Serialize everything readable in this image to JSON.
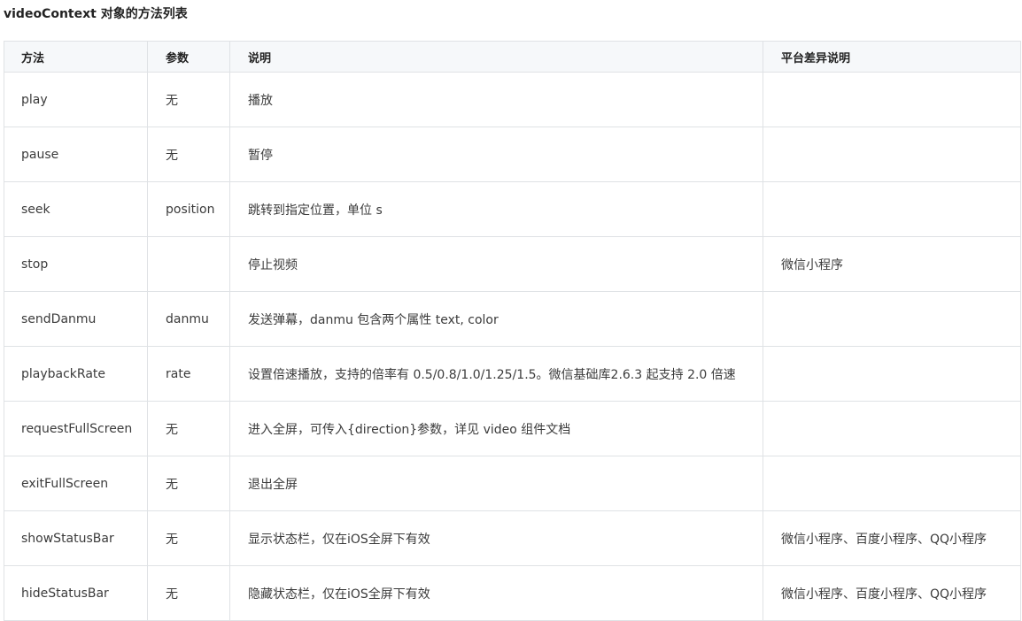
{
  "title": "videoContext 对象的方法列表",
  "table": {
    "headers": [
      "方法",
      "参数",
      "说明",
      "平台差异说明"
    ],
    "rows": [
      [
        "play",
        "无",
        "播放",
        ""
      ],
      [
        "pause",
        "无",
        "暂停",
        ""
      ],
      [
        "seek",
        "position",
        "跳转到指定位置，单位 s",
        ""
      ],
      [
        "stop",
        "",
        "停止视频",
        "微信小程序"
      ],
      [
        "sendDanmu",
        "danmu",
        "发送弹幕，danmu 包含两个属性 text, color",
        ""
      ],
      [
        "playbackRate",
        "rate",
        "设置倍速播放，支持的倍率有 0.5/0.8/1.0/1.25/1.5。微信基础库2.6.3 起支持 2.0 倍速",
        ""
      ],
      [
        "requestFullScreen",
        "无",
        "进入全屏，可传入{direction}参数，详见 video 组件文档",
        ""
      ],
      [
        "exitFullScreen",
        "无",
        "退出全屏",
        ""
      ],
      [
        "showStatusBar",
        "无",
        "显示状态栏，仅在iOS全屏下有效",
        "微信小程序、百度小程序、QQ小程序"
      ],
      [
        "hideStatusBar",
        "无",
        "隐藏状态栏，仅在iOS全屏下有效",
        "微信小程序、百度小程序、QQ小程序"
      ]
    ]
  }
}
